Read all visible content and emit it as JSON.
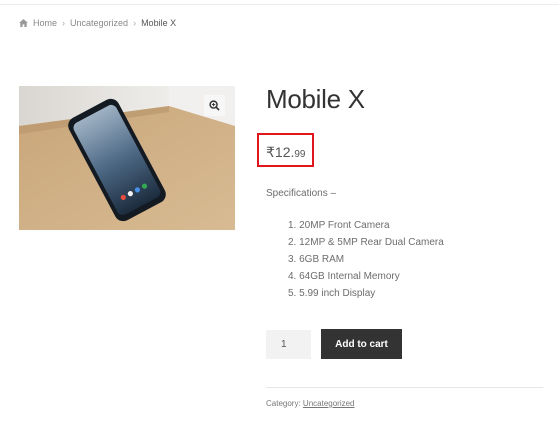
{
  "breadcrumb": {
    "home": "Home",
    "category": "Uncategorized",
    "current": "Mobile X",
    "separator": "›"
  },
  "product": {
    "title": "Mobile X",
    "price_whole": "₹12.",
    "price_decimal": "99",
    "spec_heading": "Specifications –",
    "specs": [
      "1. 20MP Front Camera",
      "2. 12MP & 5MP Rear Dual Camera",
      "3. 6GB RAM",
      "4. 64GB Internal Memory",
      "5. 5.99 inch Display"
    ],
    "quantity": "1",
    "add_to_cart_label": "Add to cart",
    "category_label": "Category:",
    "category_value": "Uncategorized"
  },
  "colors": {
    "highlight_box": "#e0161d",
    "button_bg": "#333333"
  },
  "icons": {
    "home": "home-icon",
    "zoom": "zoom-in-icon"
  }
}
